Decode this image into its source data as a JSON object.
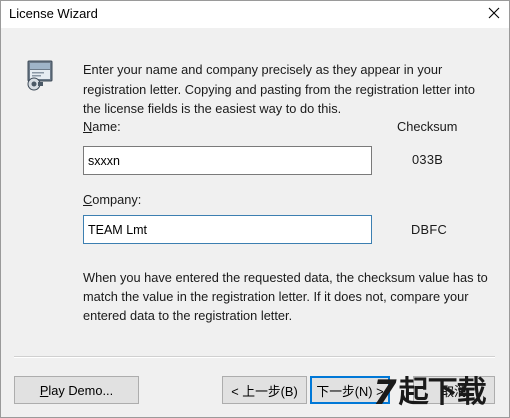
{
  "window": {
    "title": "License Wizard",
    "close_glyph": "✕"
  },
  "intro_text": "Enter your name and company precisely as they appear in your registration letter.  Copying and pasting from the registration letter into the license fields is the easiest way to do this.",
  "name_field": {
    "label_accel": "N",
    "label_rest": "ame:",
    "value": "sxxxn",
    "checksum": "033B"
  },
  "company_field": {
    "label_accel": "C",
    "label_rest": "ompany:",
    "value": "TEAM Lmt",
    "checksum": "DBFC"
  },
  "checksum_header": "Checksum",
  "note_text": "When you have entered the requested data, the checksum value has to match the value in the registration letter.  If it does not, compare your entered data to the registration letter.",
  "buttons": {
    "play_demo": {
      "accel": "P",
      "rest": "lay Demo..."
    },
    "back": "< 上一步(B)",
    "next": "下一步(N) >",
    "cancel": "取消"
  },
  "watermark": {
    "seven": "7",
    "text": "起下载"
  },
  "icons": {
    "app": "license-app-icon",
    "close": "close-icon"
  }
}
